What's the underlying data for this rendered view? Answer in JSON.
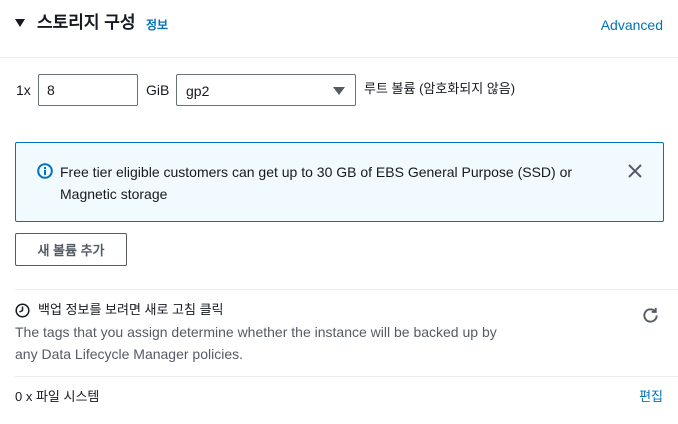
{
  "header": {
    "caret_icon": "caret-down-filled-icon",
    "title": "스토리지 구성",
    "info_link": "정보",
    "advanced_link": "Advanced"
  },
  "volume": {
    "count_label": "1x",
    "size_value": "8",
    "unit": "GiB",
    "type_selected": "gp2",
    "type_caret_icon": "caret-down-icon",
    "description": "루트 볼륨  (암호화되지 않음)"
  },
  "alert": {
    "icon": "info-circle-icon",
    "text": "Free tier eligible customers can get up to 30 GB of EBS General Purpose (SSD) or Magnetic storage",
    "close_icon": "close-icon"
  },
  "add_volume_button": "새 볼륨 추가",
  "backup": {
    "icon": "clock-icon",
    "title": "백업 정보를 보려면 새로 고침 클릭",
    "description": "The tags that you assign determine whether the instance will be backed up by any Data Lifecycle Manager policies.",
    "refresh_icon": "refresh-icon"
  },
  "file_systems": {
    "label": "0 x 파일 시스템",
    "edit_link": "편집"
  },
  "colors": {
    "link": "#0073bb",
    "text": "#16191f",
    "secondary_text": "#545b64",
    "alert_bg": "#f1faff",
    "alert_border": "#0073bb"
  }
}
